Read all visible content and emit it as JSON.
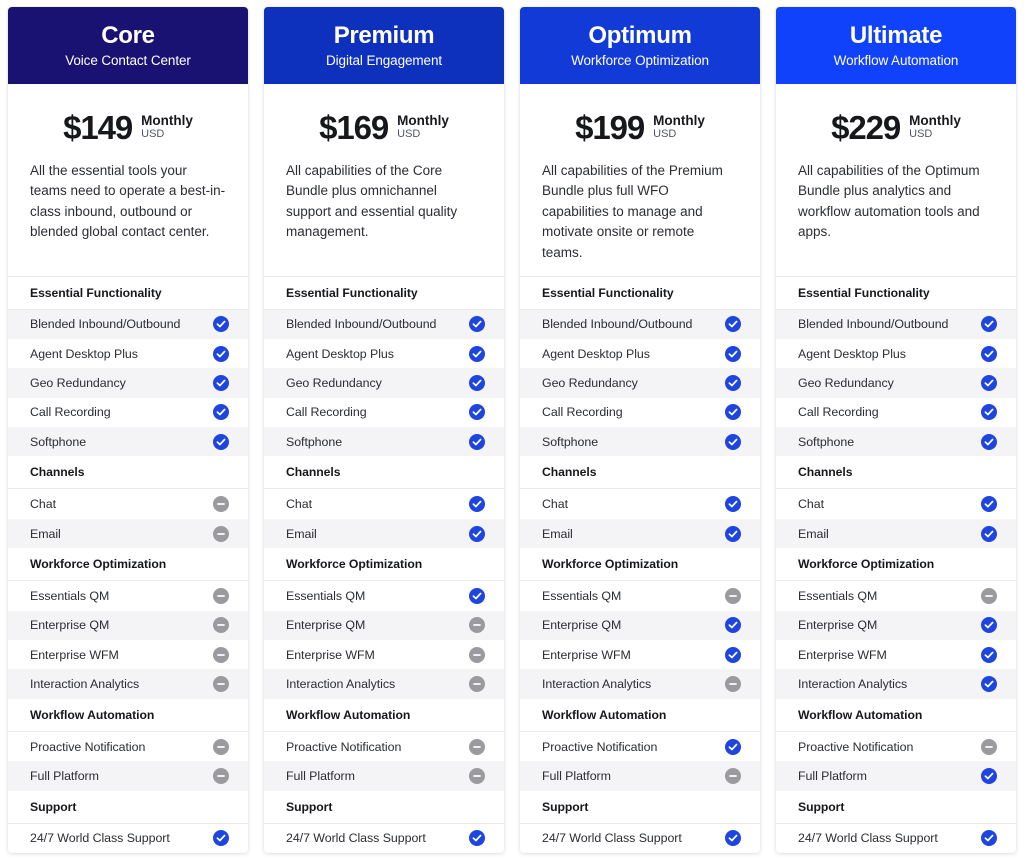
{
  "colors": {
    "included": "#1f45e0",
    "excluded": "#9b9b9f",
    "row_alt": "#f4f4f6",
    "page_bg": "#ffffff"
  },
  "icons": {
    "included": "check-circle-icon",
    "excluded": "minus-circle-icon"
  },
  "plans": [
    {
      "name": "Core",
      "subtitle": "Voice Contact Center",
      "header_color": "#1a1273",
      "price": "$149",
      "period": "Monthly",
      "currency": "USD",
      "description": "All the essential tools your teams need to operate a best-in-class inbound, outbound or blended global contact center.",
      "sections": [
        {
          "title": "Essential Functionality",
          "features": [
            {
              "label": "Blended Inbound/Outbound",
              "included": true
            },
            {
              "label": "Agent Desktop Plus",
              "included": true
            },
            {
              "label": "Geo Redundancy",
              "included": true
            },
            {
              "label": "Call Recording",
              "included": true
            },
            {
              "label": "Softphone",
              "included": true
            }
          ]
        },
        {
          "title": "Channels",
          "features": [
            {
              "label": "Chat",
              "included": false
            },
            {
              "label": "Email",
              "included": false
            }
          ]
        },
        {
          "title": "Workforce Optimization",
          "features": [
            {
              "label": "Essentials QM",
              "included": false
            },
            {
              "label": "Enterprise QM",
              "included": false
            },
            {
              "label": "Enterprise WFM",
              "included": false
            },
            {
              "label": "Interaction Analytics",
              "included": false
            }
          ]
        },
        {
          "title": "Workflow Automation",
          "features": [
            {
              "label": "Proactive Notification",
              "included": false
            },
            {
              "label": "Full Platform",
              "included": false
            }
          ]
        },
        {
          "title": "Support",
          "features": [
            {
              "label": "24/7 World Class Support",
              "included": true
            }
          ]
        }
      ]
    },
    {
      "name": "Premium",
      "subtitle": "Digital Engagement",
      "header_color": "#0d31bd",
      "price": "$169",
      "period": "Monthly",
      "currency": "USD",
      "description": "All capabilities of the Core Bundle plus omnichannel support and essential quality management.",
      "sections": [
        {
          "title": "Essential Functionality",
          "features": [
            {
              "label": "Blended Inbound/Outbound",
              "included": true
            },
            {
              "label": "Agent Desktop Plus",
              "included": true
            },
            {
              "label": "Geo Redundancy",
              "included": true
            },
            {
              "label": "Call Recording",
              "included": true
            },
            {
              "label": "Softphone",
              "included": true
            }
          ]
        },
        {
          "title": "Channels",
          "features": [
            {
              "label": "Chat",
              "included": true
            },
            {
              "label": "Email",
              "included": true
            }
          ]
        },
        {
          "title": "Workforce Optimization",
          "features": [
            {
              "label": "Essentials QM",
              "included": true
            },
            {
              "label": "Enterprise QM",
              "included": false
            },
            {
              "label": "Enterprise WFM",
              "included": false
            },
            {
              "label": "Interaction Analytics",
              "included": false
            }
          ]
        },
        {
          "title": "Workflow Automation",
          "features": [
            {
              "label": "Proactive Notification",
              "included": false
            },
            {
              "label": "Full Platform",
              "included": false
            }
          ]
        },
        {
          "title": "Support",
          "features": [
            {
              "label": "24/7 World Class Support",
              "included": true
            }
          ]
        }
      ]
    },
    {
      "name": "Optimum",
      "subtitle": "Workforce Optimization",
      "header_color": "#123ad6",
      "price": "$199",
      "period": "Monthly",
      "currency": "USD",
      "description": "All capabilities of the Premium Bundle plus full WFO capabilities to manage and motivate onsite or remote teams.",
      "sections": [
        {
          "title": "Essential Functionality",
          "features": [
            {
              "label": "Blended Inbound/Outbound",
              "included": true
            },
            {
              "label": "Agent Desktop Plus",
              "included": true
            },
            {
              "label": "Geo Redundancy",
              "included": true
            },
            {
              "label": "Call Recording",
              "included": true
            },
            {
              "label": "Softphone",
              "included": true
            }
          ]
        },
        {
          "title": "Channels",
          "features": [
            {
              "label": "Chat",
              "included": true
            },
            {
              "label": "Email",
              "included": true
            }
          ]
        },
        {
          "title": "Workforce Optimization",
          "features": [
            {
              "label": "Essentials QM",
              "included": false
            },
            {
              "label": "Enterprise QM",
              "included": true
            },
            {
              "label": "Enterprise WFM",
              "included": true
            },
            {
              "label": "Interaction Analytics",
              "included": false
            }
          ]
        },
        {
          "title": "Workflow Automation",
          "features": [
            {
              "label": "Proactive Notification",
              "included": true
            },
            {
              "label": "Full Platform",
              "included": false
            }
          ]
        },
        {
          "title": "Support",
          "features": [
            {
              "label": "24/7 World Class Support",
              "included": true
            }
          ]
        }
      ]
    },
    {
      "name": "Ultimate",
      "subtitle": "Workflow Automation",
      "header_color": "#1041fb",
      "price": "$229",
      "period": "Monthly",
      "currency": "USD",
      "description": "All capabilities of the Optimum Bundle plus analytics and workflow automation tools and apps.",
      "sections": [
        {
          "title": "Essential Functionality",
          "features": [
            {
              "label": "Blended Inbound/Outbound",
              "included": true
            },
            {
              "label": "Agent Desktop Plus",
              "included": true
            },
            {
              "label": "Geo Redundancy",
              "included": true
            },
            {
              "label": "Call Recording",
              "included": true
            },
            {
              "label": "Softphone",
              "included": true
            }
          ]
        },
        {
          "title": "Channels",
          "features": [
            {
              "label": "Chat",
              "included": true
            },
            {
              "label": "Email",
              "included": true
            }
          ]
        },
        {
          "title": "Workforce Optimization",
          "features": [
            {
              "label": "Essentials QM",
              "included": false
            },
            {
              "label": "Enterprise QM",
              "included": true
            },
            {
              "label": "Enterprise WFM",
              "included": true
            },
            {
              "label": "Interaction Analytics",
              "included": true
            }
          ]
        },
        {
          "title": "Workflow Automation",
          "features": [
            {
              "label": "Proactive Notification",
              "included": false
            },
            {
              "label": "Full Platform",
              "included": true
            }
          ]
        },
        {
          "title": "Support",
          "features": [
            {
              "label": "24/7 World Class Support",
              "included": true
            }
          ]
        }
      ]
    }
  ]
}
